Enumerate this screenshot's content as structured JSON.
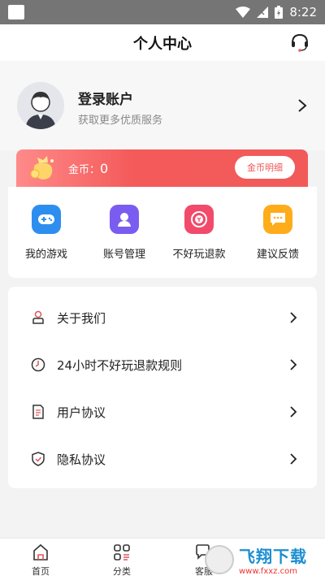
{
  "status_bar": {
    "time": "8:22"
  },
  "header": {
    "title": "个人中心",
    "support_icon": "headset-icon"
  },
  "profile": {
    "title": "登录账户",
    "subtitle": "获取更多优质服务"
  },
  "coins": {
    "label": "金币：",
    "value": "0",
    "detail_button": "金币明细",
    "banner_color": "#f45a5a"
  },
  "quick_actions": [
    {
      "label": "我的游戏",
      "icon": "gamepad-icon",
      "color": "#2e8ef0"
    },
    {
      "label": "账号管理",
      "icon": "user-icon",
      "color": "#7b5cf0"
    },
    {
      "label": "不好玩退款",
      "icon": "refund-icon",
      "color": "#f24a6b"
    },
    {
      "label": "建议反馈",
      "icon": "feedback-icon",
      "color": "#ffac1a"
    }
  ],
  "menu": [
    {
      "label": "关于我们",
      "icon": "about-icon"
    },
    {
      "label": "24小时不好玩退款规则",
      "icon": "clock-icon"
    },
    {
      "label": "用户协议",
      "icon": "document-icon"
    },
    {
      "label": "隐私协议",
      "icon": "shield-check-icon"
    }
  ],
  "tabbar": [
    {
      "label": "首页",
      "icon": "home-icon"
    },
    {
      "label": "分类",
      "icon": "category-icon"
    },
    {
      "label": "客服",
      "icon": "chat-icon"
    }
  ],
  "watermark": {
    "text": "飞翔下载",
    "sub": "www.fxxz.com"
  }
}
